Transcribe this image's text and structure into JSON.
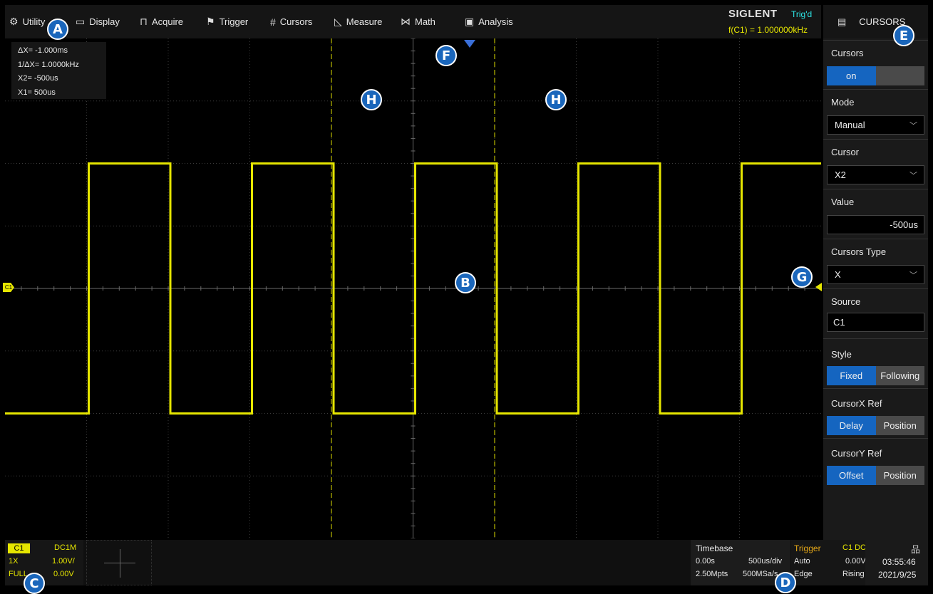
{
  "menu": {
    "items": [
      {
        "label": "Utility",
        "icon": "gear-icon",
        "glyph": "⚙"
      },
      {
        "label": "Display",
        "icon": "monitor-icon",
        "glyph": "▭"
      },
      {
        "label": "Acquire",
        "icon": "acquire-icon",
        "glyph": "⊓"
      },
      {
        "label": "Trigger",
        "icon": "flag-icon",
        "glyph": "⚑"
      },
      {
        "label": "Cursors",
        "icon": "cursors-grid-icon",
        "glyph": "#"
      },
      {
        "label": "Measure",
        "icon": "measure-icon",
        "glyph": "◺"
      },
      {
        "label": "Math",
        "icon": "math-icon",
        "glyph": "⋈"
      },
      {
        "label": "Analysis",
        "icon": "analysis-icon",
        "glyph": "▣"
      }
    ]
  },
  "brand": {
    "name": "SIGLENT",
    "trigger_status": "Trig'd",
    "frequency": "f(C1) = 1.000000kHz"
  },
  "cursor_readout": [
    "ΔX= -1.000ms",
    "1/ΔX= 1.0000kHz",
    "X2= -500us",
    "X1= 500us"
  ],
  "channel_marker": "C1",
  "panel": {
    "title": "CURSORS",
    "cursors_label": "Cursors",
    "cursors_on": "on",
    "cursors_off": "",
    "mode_label": "Mode",
    "mode_value": "Manual",
    "cursor_label": "Cursor",
    "cursor_value": "X2",
    "value_label": "Value",
    "value": "-500us",
    "type_label": "Cursors Type",
    "type_value": "X",
    "source_label": "Source",
    "source_value": "C1",
    "style_label": "Style",
    "style_options": [
      "Fixed",
      "Following"
    ],
    "xref_label": "CursorX Ref",
    "xref_options": [
      "Delay",
      "Position"
    ],
    "yref_label": "CursorY Ref",
    "yref_options": [
      "Offset",
      "Position"
    ]
  },
  "channel_info": {
    "name": "C1",
    "coupling": "DC1M",
    "probe": "1X",
    "scale": "1.00V/",
    "bw": "FULL",
    "offset": "0.00V"
  },
  "timebase": {
    "label": "Timebase",
    "delay": "0.00s",
    "scale": "500us/div",
    "points": "2.50Mpts",
    "rate": "500MSa/s"
  },
  "trigger": {
    "label": "Trigger",
    "source": "C1 DC",
    "mode": "Auto",
    "level": "0.00V",
    "type": "Edge",
    "slope": "Rising"
  },
  "clock": {
    "time": "03:55:46",
    "date": "2021/9/25"
  },
  "callouts": [
    "A",
    "B",
    "C",
    "D",
    "E",
    "F",
    "G",
    "H",
    "H"
  ],
  "colors": {
    "trace": "#e6e600",
    "cursor": "#b8b800",
    "accent": "#1565c0",
    "trigger_pointer": "#3a6fd8",
    "callout": "#1a66bb"
  }
}
